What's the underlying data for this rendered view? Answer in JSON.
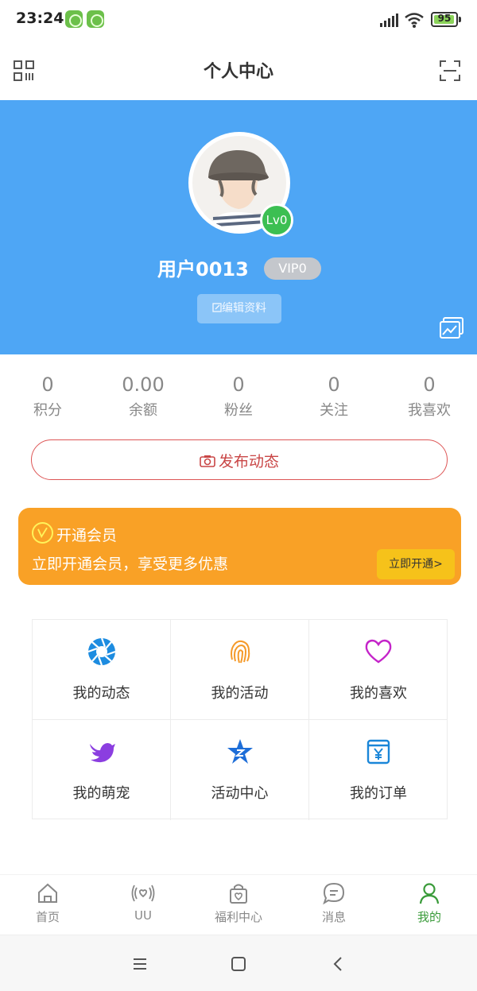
{
  "status_bar": {
    "time": "23:24",
    "battery": "95",
    "battery_level": 0.95
  },
  "header": {
    "title": "个人中心",
    "left_icon": "qr-code-icon",
    "right_icon": "scan-icon"
  },
  "profile": {
    "username": "用户0013",
    "vip": "VIP0",
    "level": "Lv0",
    "edit_label": "编辑资料",
    "banner_color": "#4ea6f5"
  },
  "stats": [
    {
      "value": "0",
      "label": "积分"
    },
    {
      "value": "0.00",
      "label": "余额"
    },
    {
      "value": "0",
      "label": "粉丝"
    },
    {
      "value": "0",
      "label": "关注"
    },
    {
      "value": "0",
      "label": "我喜欢"
    }
  ],
  "publish": {
    "label": "发布动态",
    "icon": "camera-icon"
  },
  "member": {
    "title": "开通会员",
    "subtitle": "立即开通会员，享受更多优惠",
    "button": "立即开通>",
    "color": "#f9a126"
  },
  "features": [
    {
      "label": "我的动态",
      "icon": "aperture-icon"
    },
    {
      "label": "我的活动",
      "icon": "fingerprint-icon"
    },
    {
      "label": "我的喜欢",
      "icon": "heart-icon"
    },
    {
      "label": "我的萌宠",
      "icon": "bird-icon"
    },
    {
      "label": "活动中心",
      "icon": "star-icon"
    },
    {
      "label": "我的订单",
      "icon": "order-icon"
    }
  ],
  "tabs": [
    {
      "label": "首页",
      "icon": "home-icon",
      "active": false
    },
    {
      "label": "UU",
      "icon": "broadcast-heart-icon",
      "active": false
    },
    {
      "label": "福利中心",
      "icon": "gift-bag-icon",
      "active": false
    },
    {
      "label": "消息",
      "icon": "message-icon",
      "active": false
    },
    {
      "label": "我的",
      "icon": "user-icon",
      "active": true
    }
  ],
  "accent_color": "#3a9b3a"
}
